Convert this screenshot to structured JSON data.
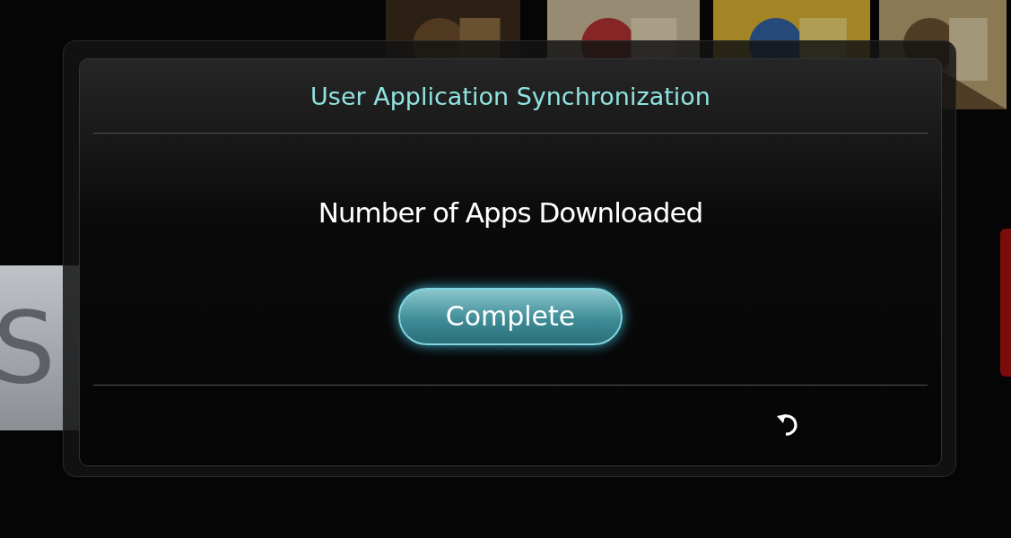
{
  "background": {
    "side_tile": {
      "text": "S"
    }
  },
  "dialog": {
    "title": "User Application Synchronization",
    "message": "Number of Apps Downloaded",
    "buttons": [
      {
        "label": "Complete",
        "selected": true
      }
    ]
  }
}
